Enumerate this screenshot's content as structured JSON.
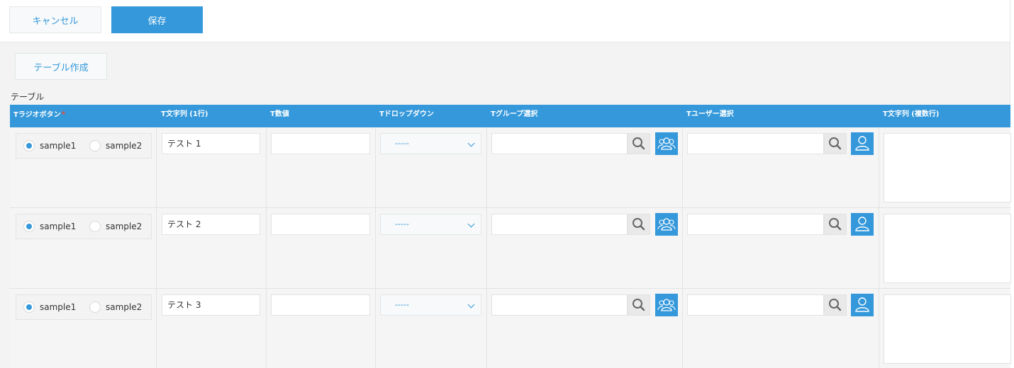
{
  "toolbar": {
    "cancel_label": "キャンセル",
    "save_label": "保存"
  },
  "create_table_label": "テーブル作成",
  "table": {
    "label": "テーブル",
    "columns": [
      "Tラジオボタン",
      "T文字列 (1行)",
      "T数値",
      "Tドロップダウン",
      "Tグループ選択",
      "Tユーザー選択",
      "T文字列 (複数行)"
    ],
    "required_mark": "*",
    "rows": [
      {
        "radio_options": [
          "sample1",
          "sample2"
        ],
        "radio_selected": "sample1",
        "text": "テスト 1",
        "number": "",
        "dropdown": "-----",
        "group": "",
        "user": "",
        "multiline": ""
      },
      {
        "radio_options": [
          "sample1",
          "sample2"
        ],
        "radio_selected": "sample1",
        "text": "テスト 2",
        "number": "",
        "dropdown": "-----",
        "group": "",
        "user": "",
        "multiline": ""
      },
      {
        "radio_options": [
          "sample1",
          "sample2"
        ],
        "radio_selected": "sample1",
        "text": "テスト 3",
        "number": "",
        "dropdown": "-----",
        "group": "",
        "user": "",
        "multiline": ""
      }
    ]
  },
  "icons": {
    "search": "search-icon",
    "group": "group-icon",
    "user": "user-icon",
    "dropdown": "chevron-down-icon"
  },
  "colors": {
    "accent": "#3498db",
    "header_text": "#ffffff",
    "required": "#e74c3c"
  }
}
